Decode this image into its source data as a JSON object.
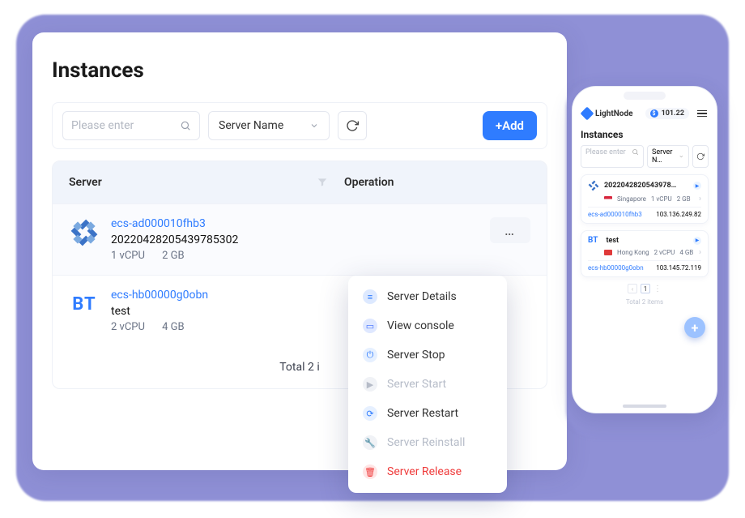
{
  "page": {
    "title": "Instances",
    "search_placeholder": "Please enter",
    "filter_label": "Server Name",
    "add_label": "+Add",
    "footer_total": "Total 2 i"
  },
  "table": {
    "col_server": "Server",
    "col_operation": "Operation"
  },
  "rows": [
    {
      "os": "centos",
      "link": "ecs-ad000010fhb3",
      "subtitle": "20220428205439785302",
      "cpu": "1 vCPU",
      "mem": "2 GB"
    },
    {
      "os": "bt",
      "bt_label": "BT",
      "link": "ecs-hb00000g0obn",
      "subtitle": "test",
      "cpu": "2 vCPU",
      "mem": "4 GB"
    }
  ],
  "menu": {
    "details": "Server Details",
    "console": "View console",
    "stop": "Server Stop",
    "start": "Server Start",
    "restart": "Server Restart",
    "reinstall": "Server Reinstall",
    "release": "Server Release"
  },
  "phone": {
    "brand": "LightNode",
    "balance": "101.22",
    "title": "Instances",
    "search_placeholder": "Please enter",
    "filter_label": "Server N…",
    "total": "Total 2 items",
    "page_current": "1",
    "cards": [
      {
        "os": "centos",
        "title": "2022042820543978…",
        "region": "Singapore",
        "cpu": "1 vCPU",
        "mem": "2 GB",
        "link": "ecs-ad000010fhb3",
        "ip": "103.136.249.82"
      },
      {
        "os": "bt",
        "bt_label": "BT",
        "title": "test",
        "region": "Hong Kong",
        "cpu": "2 vCPU",
        "mem": "4 GB",
        "link": "ecs-hb00000g0obn",
        "ip": "103.145.72.119"
      }
    ]
  }
}
